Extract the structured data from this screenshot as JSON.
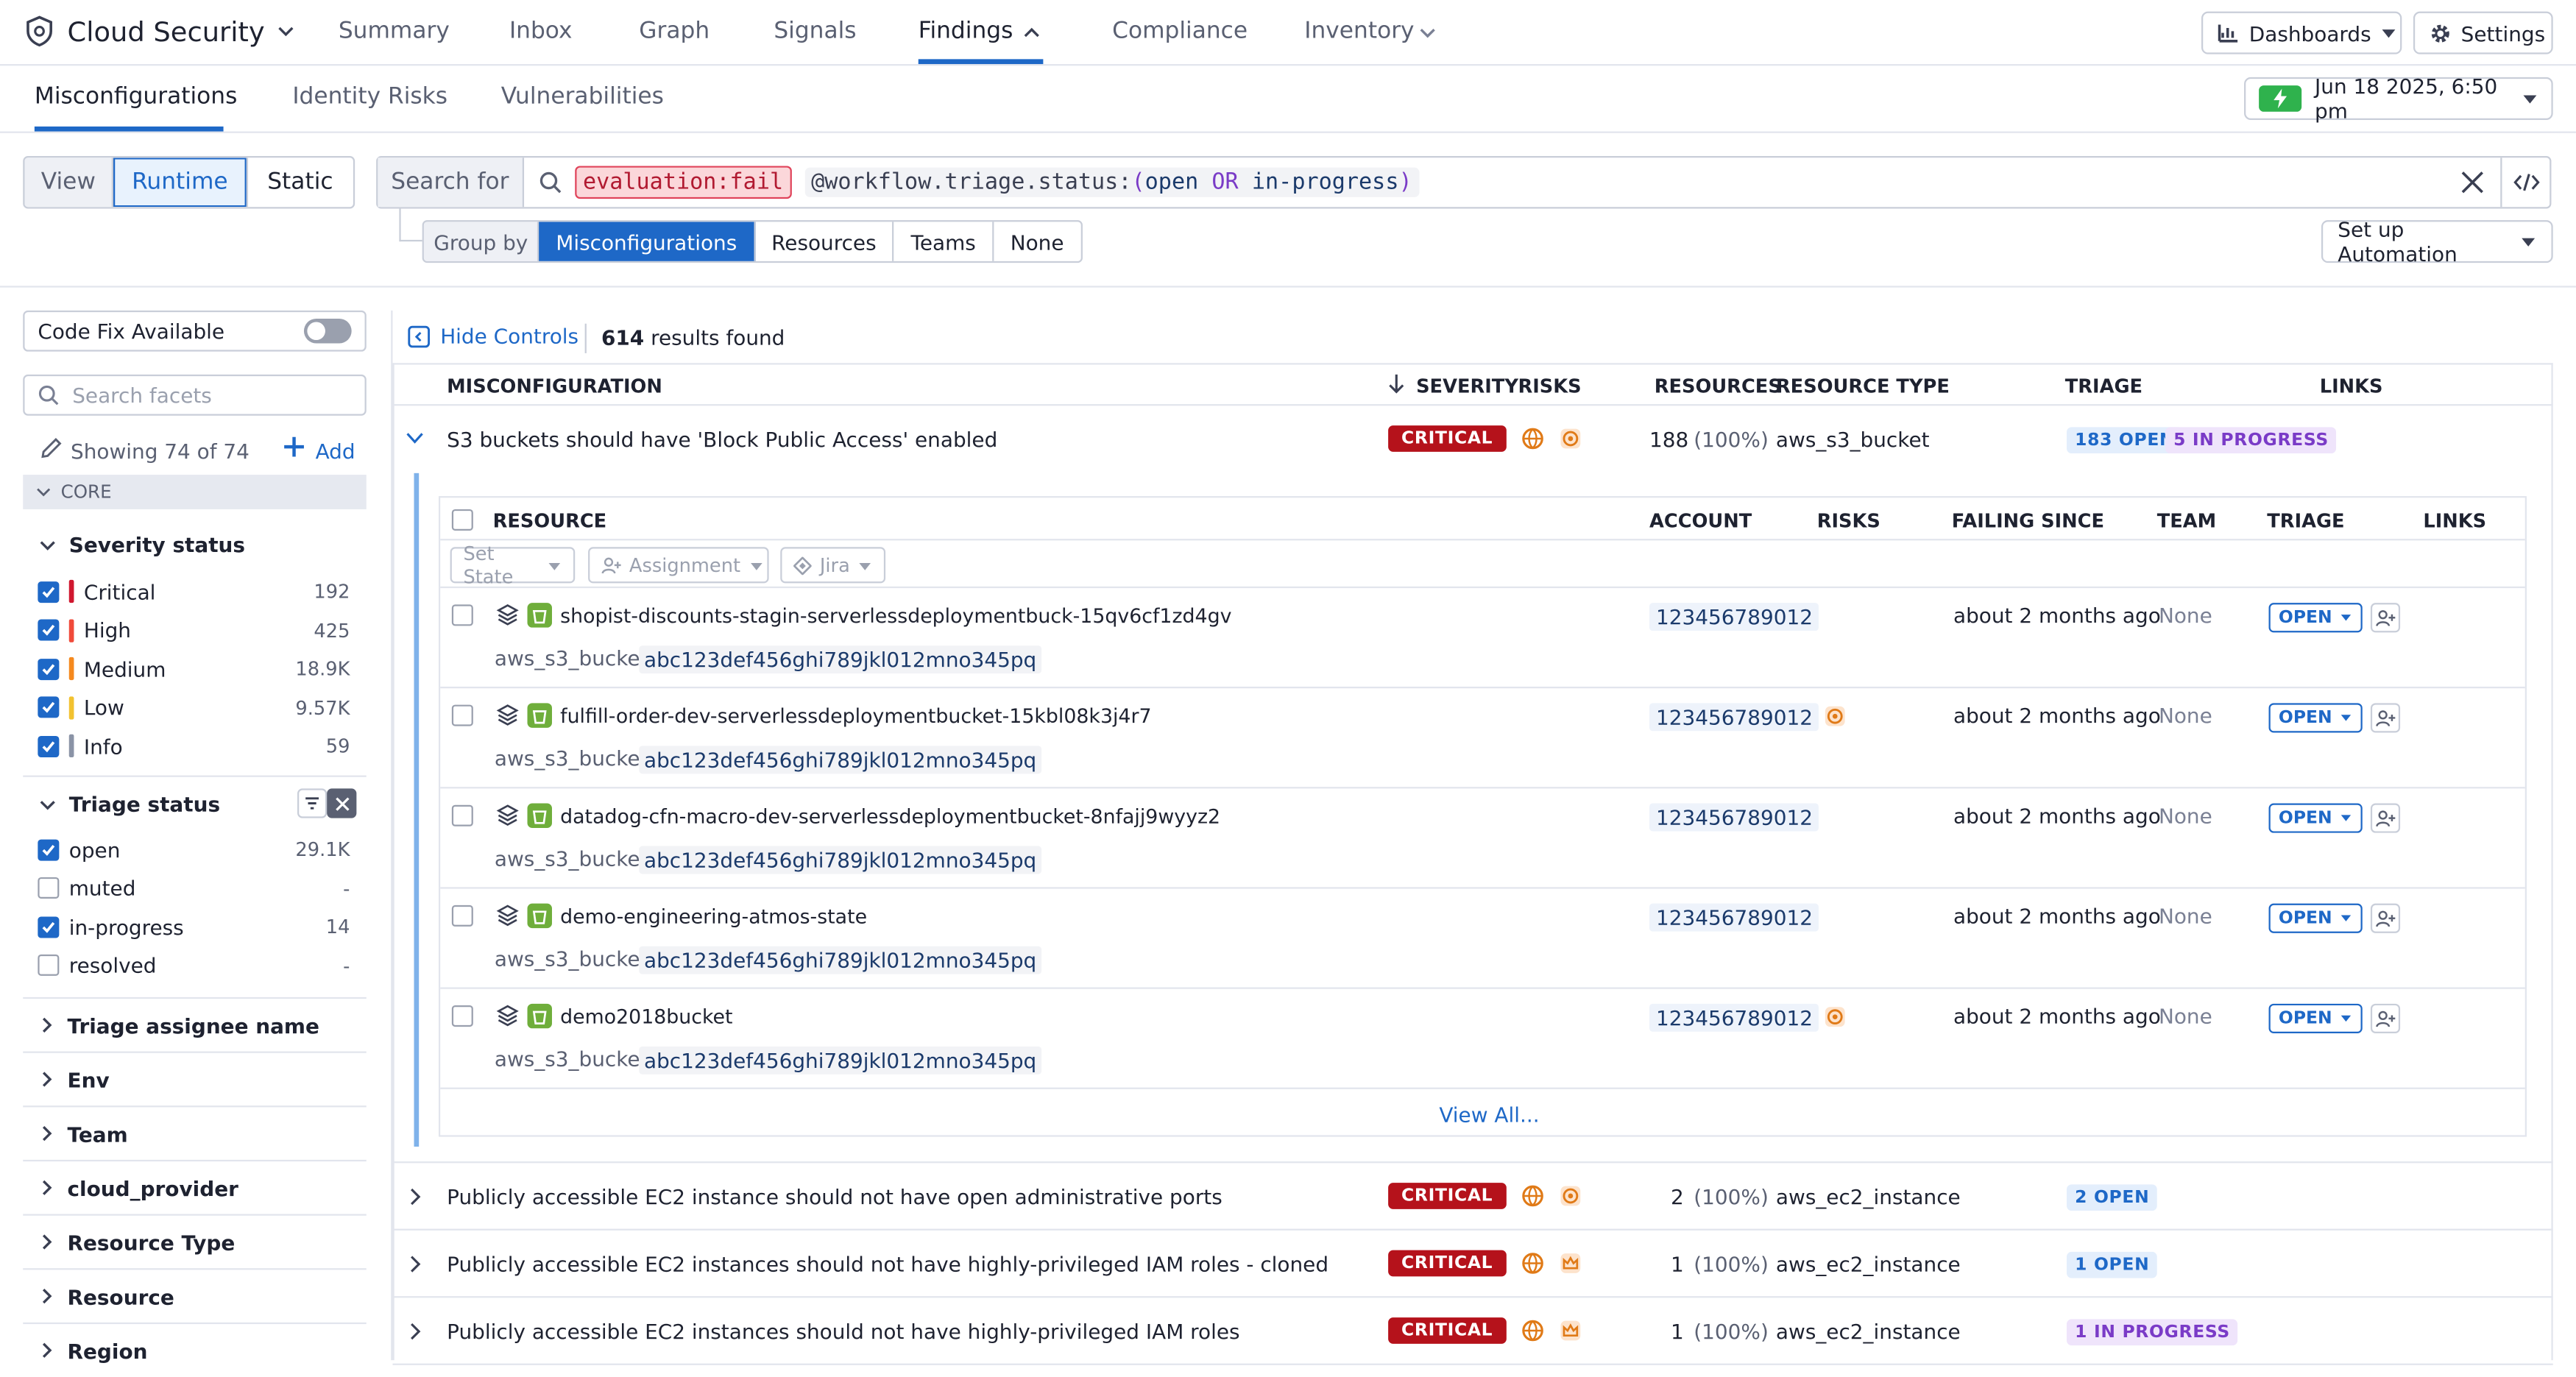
{
  "app": {
    "title": "Cloud Security"
  },
  "nav": {
    "items": [
      "Summary",
      "Inbox",
      "Graph",
      "Signals",
      "Findings",
      "Compliance",
      "Inventory"
    ],
    "active": "Findings",
    "dashboards": "Dashboards",
    "settings": "Settings"
  },
  "subnav": {
    "tabs": [
      "Misconfigurations",
      "Identity Risks",
      "Vulnerabilities"
    ],
    "active": "Misconfigurations",
    "time": "Jun 18 2025, 6:50 pm"
  },
  "view": {
    "label": "View",
    "options": [
      "Runtime",
      "Static"
    ],
    "selected": "Runtime"
  },
  "search": {
    "label": "Search for",
    "query_fail": "evaluation:fail",
    "q_attr": "@workflow.triage.status:",
    "q_open_paren": "(",
    "q_open": "open",
    "q_or": "OR",
    "q_inprog": "in-progress",
    "q_close_paren": ")"
  },
  "groupby": {
    "label": "Group by",
    "options": [
      "Misconfigurations",
      "Resources",
      "Teams",
      "None"
    ],
    "selected": "Misconfigurations"
  },
  "automation": {
    "label": "Set up Automation"
  },
  "controls": {
    "hide": "Hide Controls",
    "results_count": "614",
    "results_suffix": "results found"
  },
  "facets": {
    "code_fix": "Code Fix Available",
    "search_placeholder": "Search facets",
    "showing": "Showing 74 of 74",
    "add": "Add",
    "core": "CORE",
    "severity": {
      "title": "Severity status",
      "items": [
        {
          "label": "Critical",
          "count": "192",
          "color": "#d0172f"
        },
        {
          "label": "High",
          "count": "425",
          "color": "#f04a3a"
        },
        {
          "label": "Medium",
          "count": "18.9K",
          "color": "#f5891e"
        },
        {
          "label": "Low",
          "count": "9.57K",
          "color": "#f2c230"
        },
        {
          "label": "Info",
          "count": "59",
          "color": "#8a93a6"
        }
      ]
    },
    "triage": {
      "title": "Triage status",
      "items": [
        {
          "label": "open",
          "count": "29.1K",
          "checked": true
        },
        {
          "label": "muted",
          "count": "-",
          "checked": false
        },
        {
          "label": "in-progress",
          "count": "14",
          "checked": true
        },
        {
          "label": "resolved",
          "count": "-",
          "checked": false
        }
      ]
    },
    "groups": [
      "Triage assignee name",
      "Env",
      "Team",
      "cloud_provider",
      "Resource Type",
      "Resource",
      "Region"
    ]
  },
  "table": {
    "headers": [
      "MISCONFIGURATION",
      "SEVERITY",
      "RISKS",
      "RESOURCES",
      "RESOURCE TYPE",
      "TRIAGE",
      "LINKS"
    ],
    "expanded": {
      "title": "S3 buckets should have 'Block Public Access' enabled",
      "severity": "CRITICAL",
      "resources": "188",
      "pct": "(100%)",
      "type": "aws_s3_bucket",
      "badges": [
        "183 OPEN",
        "5 IN PROGRESS"
      ]
    },
    "sub": {
      "headers": [
        "RESOURCE",
        "ACCOUNT",
        "RISKS",
        "FAILING SINCE",
        "TEAM",
        "TRIAGE",
        "LINKS"
      ],
      "actions": [
        "Set State",
        "Assignment",
        "Jira"
      ],
      "rows": [
        {
          "name": "shopist-discounts-stagin-serverlessdeploymentbuck-15qv6cf1zd4gv",
          "type_label": "aws_s3_bucket:",
          "id": "abc123def456ghi789jkl012mno345pq",
          "account": "123456789012",
          "risk": false,
          "since": "about 2 months ago",
          "team": "None",
          "triage": "OPEN"
        },
        {
          "name": "fulfill-order-dev-serverlessdeploymentbucket-15kbl08k3j4r7",
          "type_label": "aws_s3_bucket:",
          "id": "abc123def456ghi789jkl012mno345pq",
          "account": "123456789012",
          "risk": true,
          "since": "about 2 months ago",
          "team": "None",
          "triage": "OPEN"
        },
        {
          "name": "datadog-cfn-macro-dev-serverlessdeploymentbucket-8nfajj9wyyz2",
          "type_label": "aws_s3_bucket:",
          "id": "abc123def456ghi789jkl012mno345pq",
          "account": "123456789012",
          "risk": false,
          "since": "about 2 months ago",
          "team": "None",
          "triage": "OPEN"
        },
        {
          "name": "demo-engineering-atmos-state",
          "type_label": "aws_s3_bucket:",
          "id": "abc123def456ghi789jkl012mno345pq",
          "account": "123456789012",
          "risk": false,
          "since": "about 2 months ago",
          "team": "None",
          "triage": "OPEN"
        },
        {
          "name": "demo2018bucket",
          "type_label": "aws_s3_bucket:",
          "id": "abc123def456ghi789jkl012mno345pq",
          "account": "123456789012",
          "risk": true,
          "since": "about 2 months ago",
          "team": "None",
          "triage": "OPEN"
        }
      ],
      "view_all": "View All..."
    },
    "rows": [
      {
        "title": "Publicly accessible EC2 instance should not have open administrative ports",
        "severity": "CRITICAL",
        "resources": "2",
        "pct": "(100%)",
        "type": "aws_ec2_instance",
        "badge": "2 OPEN",
        "badge_kind": "open",
        "risk2": "radar-icon"
      },
      {
        "title": "Publicly accessible EC2 instances should not have highly-privileged IAM roles - cloned",
        "severity": "CRITICAL",
        "resources": "1",
        "pct": "(100%)",
        "type": "aws_ec2_instance",
        "badge": "1 OPEN",
        "badge_kind": "open",
        "risk2": "crown-icon"
      },
      {
        "title": "Publicly accessible EC2 instances should not have highly-privileged IAM roles",
        "severity": "CRITICAL",
        "resources": "1",
        "pct": "(100%)",
        "type": "aws_ec2_instance",
        "badge": "1 IN PROGRESS",
        "badge_kind": "prog",
        "risk2": "crown-icon"
      }
    ]
  }
}
